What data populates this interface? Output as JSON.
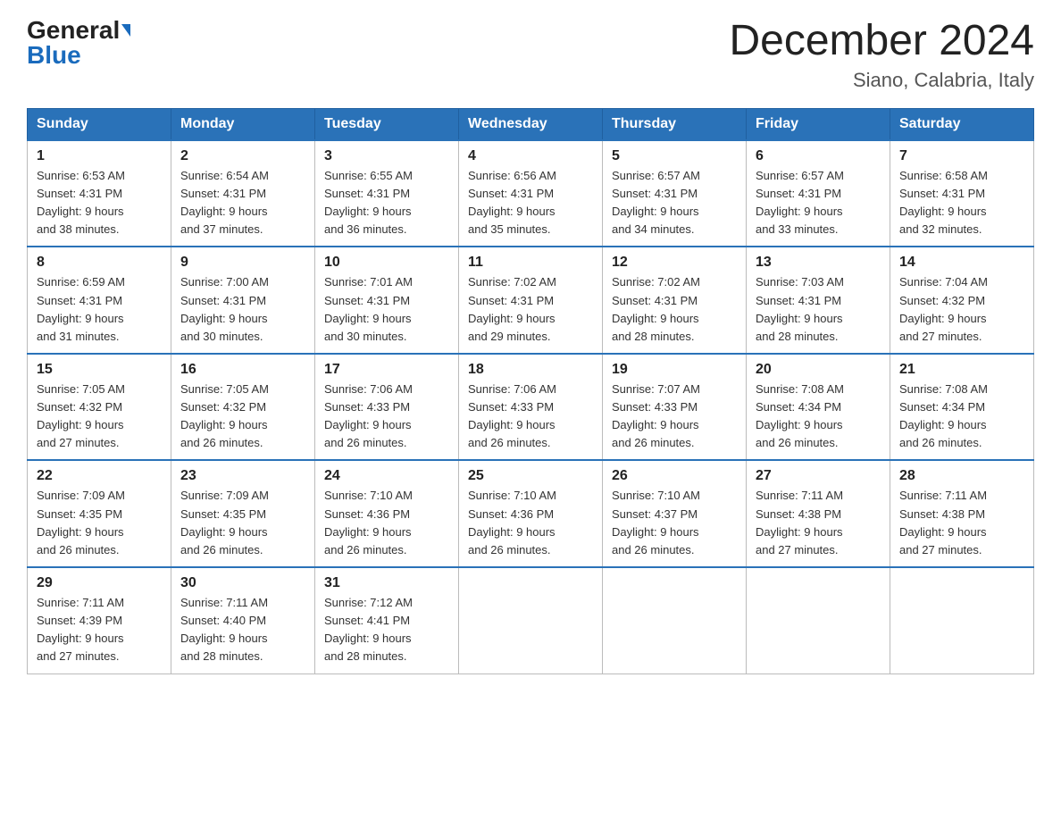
{
  "logo": {
    "general": "General",
    "blue": "Blue"
  },
  "title": "December 2024",
  "location": "Siano, Calabria, Italy",
  "days_of_week": [
    "Sunday",
    "Monday",
    "Tuesday",
    "Wednesday",
    "Thursday",
    "Friday",
    "Saturday"
  ],
  "weeks": [
    [
      {
        "day": "1",
        "sunrise": "6:53 AM",
        "sunset": "4:31 PM",
        "daylight": "9 hours and 38 minutes."
      },
      {
        "day": "2",
        "sunrise": "6:54 AM",
        "sunset": "4:31 PM",
        "daylight": "9 hours and 37 minutes."
      },
      {
        "day": "3",
        "sunrise": "6:55 AM",
        "sunset": "4:31 PM",
        "daylight": "9 hours and 36 minutes."
      },
      {
        "day": "4",
        "sunrise": "6:56 AM",
        "sunset": "4:31 PM",
        "daylight": "9 hours and 35 minutes."
      },
      {
        "day": "5",
        "sunrise": "6:57 AM",
        "sunset": "4:31 PM",
        "daylight": "9 hours and 34 minutes."
      },
      {
        "day": "6",
        "sunrise": "6:57 AM",
        "sunset": "4:31 PM",
        "daylight": "9 hours and 33 minutes."
      },
      {
        "day": "7",
        "sunrise": "6:58 AM",
        "sunset": "4:31 PM",
        "daylight": "9 hours and 32 minutes."
      }
    ],
    [
      {
        "day": "8",
        "sunrise": "6:59 AM",
        "sunset": "4:31 PM",
        "daylight": "9 hours and 31 minutes."
      },
      {
        "day": "9",
        "sunrise": "7:00 AM",
        "sunset": "4:31 PM",
        "daylight": "9 hours and 30 minutes."
      },
      {
        "day": "10",
        "sunrise": "7:01 AM",
        "sunset": "4:31 PM",
        "daylight": "9 hours and 30 minutes."
      },
      {
        "day": "11",
        "sunrise": "7:02 AM",
        "sunset": "4:31 PM",
        "daylight": "9 hours and 29 minutes."
      },
      {
        "day": "12",
        "sunrise": "7:02 AM",
        "sunset": "4:31 PM",
        "daylight": "9 hours and 28 minutes."
      },
      {
        "day": "13",
        "sunrise": "7:03 AM",
        "sunset": "4:31 PM",
        "daylight": "9 hours and 28 minutes."
      },
      {
        "day": "14",
        "sunrise": "7:04 AM",
        "sunset": "4:32 PM",
        "daylight": "9 hours and 27 minutes."
      }
    ],
    [
      {
        "day": "15",
        "sunrise": "7:05 AM",
        "sunset": "4:32 PM",
        "daylight": "9 hours and 27 minutes."
      },
      {
        "day": "16",
        "sunrise": "7:05 AM",
        "sunset": "4:32 PM",
        "daylight": "9 hours and 26 minutes."
      },
      {
        "day": "17",
        "sunrise": "7:06 AM",
        "sunset": "4:33 PM",
        "daylight": "9 hours and 26 minutes."
      },
      {
        "day": "18",
        "sunrise": "7:06 AM",
        "sunset": "4:33 PM",
        "daylight": "9 hours and 26 minutes."
      },
      {
        "day": "19",
        "sunrise": "7:07 AM",
        "sunset": "4:33 PM",
        "daylight": "9 hours and 26 minutes."
      },
      {
        "day": "20",
        "sunrise": "7:08 AM",
        "sunset": "4:34 PM",
        "daylight": "9 hours and 26 minutes."
      },
      {
        "day": "21",
        "sunrise": "7:08 AM",
        "sunset": "4:34 PM",
        "daylight": "9 hours and 26 minutes."
      }
    ],
    [
      {
        "day": "22",
        "sunrise": "7:09 AM",
        "sunset": "4:35 PM",
        "daylight": "9 hours and 26 minutes."
      },
      {
        "day": "23",
        "sunrise": "7:09 AM",
        "sunset": "4:35 PM",
        "daylight": "9 hours and 26 minutes."
      },
      {
        "day": "24",
        "sunrise": "7:10 AM",
        "sunset": "4:36 PM",
        "daylight": "9 hours and 26 minutes."
      },
      {
        "day": "25",
        "sunrise": "7:10 AM",
        "sunset": "4:36 PM",
        "daylight": "9 hours and 26 minutes."
      },
      {
        "day": "26",
        "sunrise": "7:10 AM",
        "sunset": "4:37 PM",
        "daylight": "9 hours and 26 minutes."
      },
      {
        "day": "27",
        "sunrise": "7:11 AM",
        "sunset": "4:38 PM",
        "daylight": "9 hours and 27 minutes."
      },
      {
        "day": "28",
        "sunrise": "7:11 AM",
        "sunset": "4:38 PM",
        "daylight": "9 hours and 27 minutes."
      }
    ],
    [
      {
        "day": "29",
        "sunrise": "7:11 AM",
        "sunset": "4:39 PM",
        "daylight": "9 hours and 27 minutes."
      },
      {
        "day": "30",
        "sunrise": "7:11 AM",
        "sunset": "4:40 PM",
        "daylight": "9 hours and 28 minutes."
      },
      {
        "day": "31",
        "sunrise": "7:12 AM",
        "sunset": "4:41 PM",
        "daylight": "9 hours and 28 minutes."
      },
      null,
      null,
      null,
      null
    ]
  ],
  "labels": {
    "sunrise": "Sunrise:",
    "sunset": "Sunset:",
    "daylight": "Daylight:"
  }
}
